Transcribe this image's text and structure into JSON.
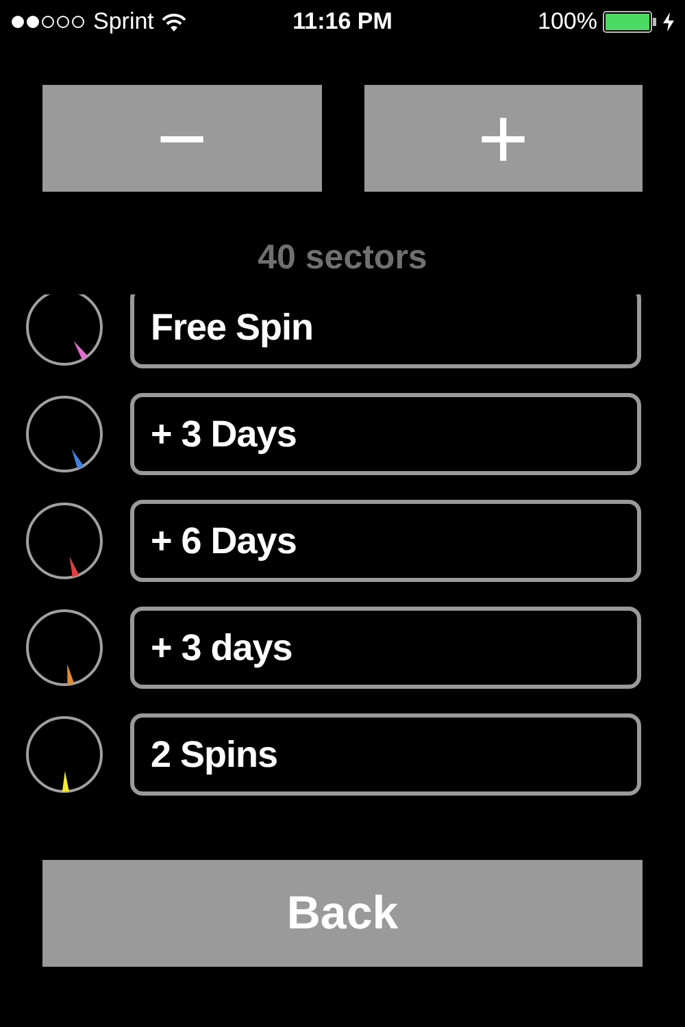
{
  "status_bar": {
    "signal_carrier": "Sprint",
    "time": "11:16 PM",
    "battery": "100%"
  },
  "stepper": {
    "decrement": "−",
    "increment": "+"
  },
  "sector_count": "40 sectors",
  "sectors": [
    {
      "label": "Free Spin",
      "color": "#e070d0"
    },
    {
      "label": "+ 3 Days",
      "color": "#3f7fe0"
    },
    {
      "label": "+ 6 Days",
      "color": "#e04040"
    },
    {
      "label": "+ 3 days",
      "color": "#e08a35"
    },
    {
      "label": "2 Spins",
      "color": "#f2ea30"
    }
  ],
  "back_button": "Back"
}
